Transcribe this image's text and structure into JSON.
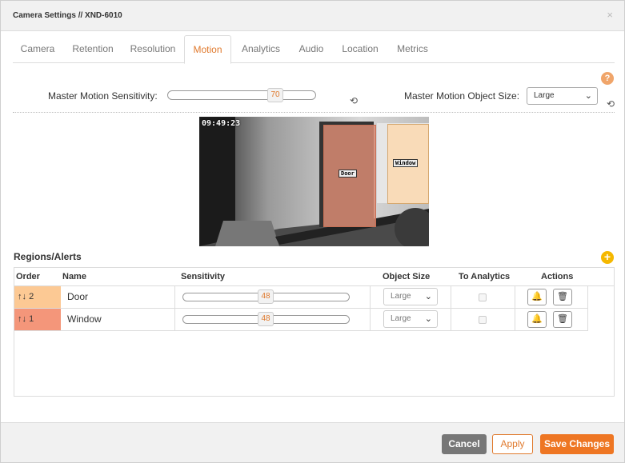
{
  "dialog": {
    "title": "Camera Settings // XND-6010",
    "close_label": "×"
  },
  "tabs": [
    {
      "label": "Camera"
    },
    {
      "label": "Retention"
    },
    {
      "label": "Resolution"
    },
    {
      "label": "Motion",
      "active": true
    },
    {
      "label": "Analytics"
    },
    {
      "label": "Audio"
    },
    {
      "label": "Location"
    },
    {
      "label": "Metrics"
    }
  ],
  "motion": {
    "help_icon": "?",
    "sensitivity_label": "Master Motion Sensitivity:",
    "sensitivity_value": "70",
    "object_size_label": "Master Motion Object Size:",
    "object_size_value": "Large"
  },
  "camera_view": {
    "timestamp": "09:49:23",
    "regions": [
      {
        "label": "Door"
      },
      {
        "label": "Window"
      }
    ]
  },
  "regions": {
    "title": "Regions/Alerts",
    "add_icon": "+",
    "columns": {
      "order": "Order",
      "name": "Name",
      "sensitivity": "Sensitivity",
      "object_size": "Object Size",
      "to_analytics": "To Analytics",
      "actions": "Actions"
    },
    "rows": [
      {
        "order_arrows": "🡑🡓",
        "order": "2",
        "name": "Door",
        "sensitivity": "48",
        "object_size": "Large",
        "color": "#fcc994"
      },
      {
        "order_arrows": "🡑🡓",
        "order": "1",
        "name": "Window",
        "sensitivity": "48",
        "object_size": "Large",
        "color": "#f4967a"
      }
    ]
  },
  "footer": {
    "cancel": "Cancel",
    "apply": "Apply",
    "save": "Save Changes"
  },
  "colors": {
    "accent": "#ee7623",
    "door_region": "#d98b73",
    "window_region": "#ffd7a8"
  }
}
